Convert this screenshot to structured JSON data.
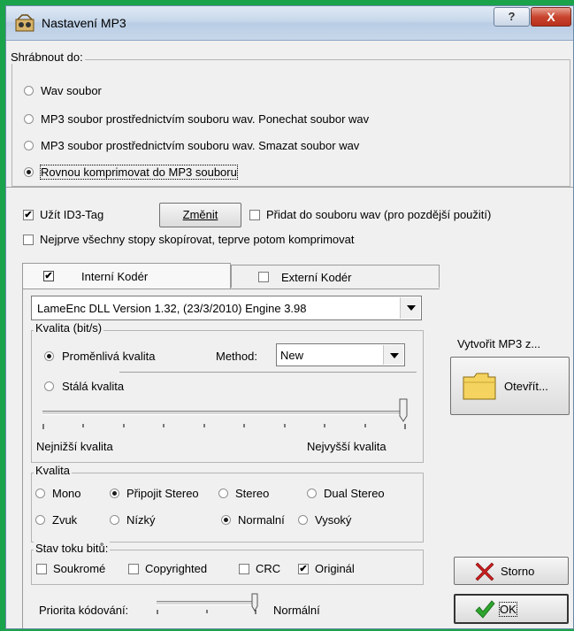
{
  "window": {
    "title": "Nastavení MP3",
    "help_label": "?",
    "close_label": "X"
  },
  "target_group": {
    "legend": "Shrábnout do:",
    "options": [
      {
        "label": "Wav soubor",
        "selected": false
      },
      {
        "label": "MP3 soubor prostřednictvím souboru wav. Ponechat soubor wav",
        "selected": false
      },
      {
        "label": "MP3 soubor prostřednictvím souboru wav. Smazat soubor wav",
        "selected": false
      },
      {
        "label": "Rovnou komprimovat do MP3 souboru",
        "selected": true
      }
    ]
  },
  "id3": {
    "use_label": "Užít ID3-Tag",
    "use_checked": true,
    "change_button": "Změnit",
    "add_wav_label": "Přidat do souboru wav (pro pozdější použití)",
    "add_wav_checked": false,
    "copy_first_label": "Nejprve všechny stopy skopírovat, teprve potom komprimovat",
    "copy_first_checked": false
  },
  "tabs": {
    "internal": {
      "label": "Interní Kodér",
      "checked": true
    },
    "external": {
      "label": "Externí Kodér",
      "checked": false
    }
  },
  "encoder_select": {
    "value": "LameEnc DLL Version 1.32, (23/3/2010) Engine 3.98"
  },
  "bitrate": {
    "legend": "Kvalita (bit/s)",
    "variable_label": "Proměnlivá kvalita",
    "variable_selected": true,
    "method_label": "Method:",
    "method_value": "New",
    "constant_label": "Stálá kvalita",
    "constant_selected": false,
    "slider_position": 1.0,
    "min_label": "Nejnižší kvalita",
    "max_label": "Nejvyšší kvalita"
  },
  "quality": {
    "legend": "Kvalita",
    "channel_options": [
      {
        "label": "Mono",
        "selected": false
      },
      {
        "label": "Připojit Stereo",
        "selected": true
      },
      {
        "label": "Stereo",
        "selected": false
      },
      {
        "label": "Dual Stereo",
        "selected": false
      }
    ],
    "level_options": [
      {
        "label": "Zvuk",
        "selected": false
      },
      {
        "label": "Nízký",
        "selected": false
      },
      {
        "label": "Normalní",
        "selected": true
      },
      {
        "label": "Vysoký",
        "selected": false
      }
    ]
  },
  "bitstream": {
    "legend": "Stav toku bitů:",
    "flags": [
      {
        "label": "Soukromé",
        "checked": false
      },
      {
        "label": "Copyrighted",
        "checked": false
      },
      {
        "label": "CRC",
        "checked": false
      },
      {
        "label": "Originál",
        "checked": true
      }
    ]
  },
  "priority": {
    "label": "Priorita kódování:",
    "value_label": "Normální",
    "slider_position": 1.0
  },
  "side": {
    "create_label": "Vytvořit MP3 z...",
    "open_button": "Otevřít...",
    "cancel_button": "Storno",
    "ok_button": "OK"
  },
  "colors": {
    "accent_green": "#1aa34a",
    "cancel_red": "#c81e1e",
    "ok_green": "#2ea52e"
  }
}
